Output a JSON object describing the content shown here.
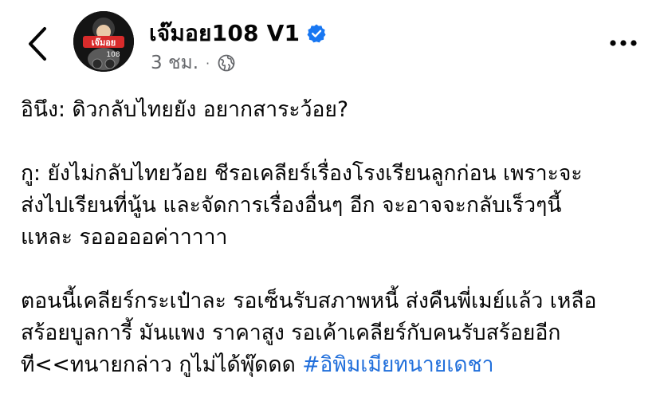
{
  "header": {
    "author_name": "เจ๊มอย108 V1",
    "avatar_text": "เจ๊มอย",
    "avatar_number": "108",
    "timestamp": "3 ชม.",
    "separator": "·",
    "icons": {
      "back": "chevron-left-icon",
      "verified": "verified-badge-icon",
      "audience": "globe-icon",
      "more": "more-horizontal-icon"
    },
    "colors": {
      "verified": "#1877f2",
      "hashtag": "#216fdb",
      "meta": "#65676b"
    }
  },
  "post": {
    "paragraphs": [
      {
        "lines": [
          "อินึง: ดิวกลับไทยยัง อยากสาระว้อย?"
        ]
      },
      {
        "lines": [
          "กู: ยังไม่กลับไทยว้อย ชีรอเคลียร์เรื่องโรงเรียนลูกก่อน เพราะจะ",
          "ส่งไปเรียนที่นู้น และจัดการเรื่องอื่นๆ อีก จะอาจจะกลับเร็วๆนี้",
          "แหละ รอออออค่าาาาา"
        ]
      },
      {
        "lines": [
          "ตอนนี้เคลียร์กระเป๋าละ รอเซ็นรับสภาพหนี้ ส่งคืนพี่เมย์แล้ว เหลือ",
          "สร้อยบูลการี้ มันแพง ราคาสูง รอเค้าเคลียร์กับคนรับสร้อยอีก"
        ],
        "last_line_text": "ที<<ทนายกล่าว กูไม่ได้พุ๊ดดด ",
        "hashtag": "#อิพิมเมียทนายเดชา"
      }
    ]
  }
}
